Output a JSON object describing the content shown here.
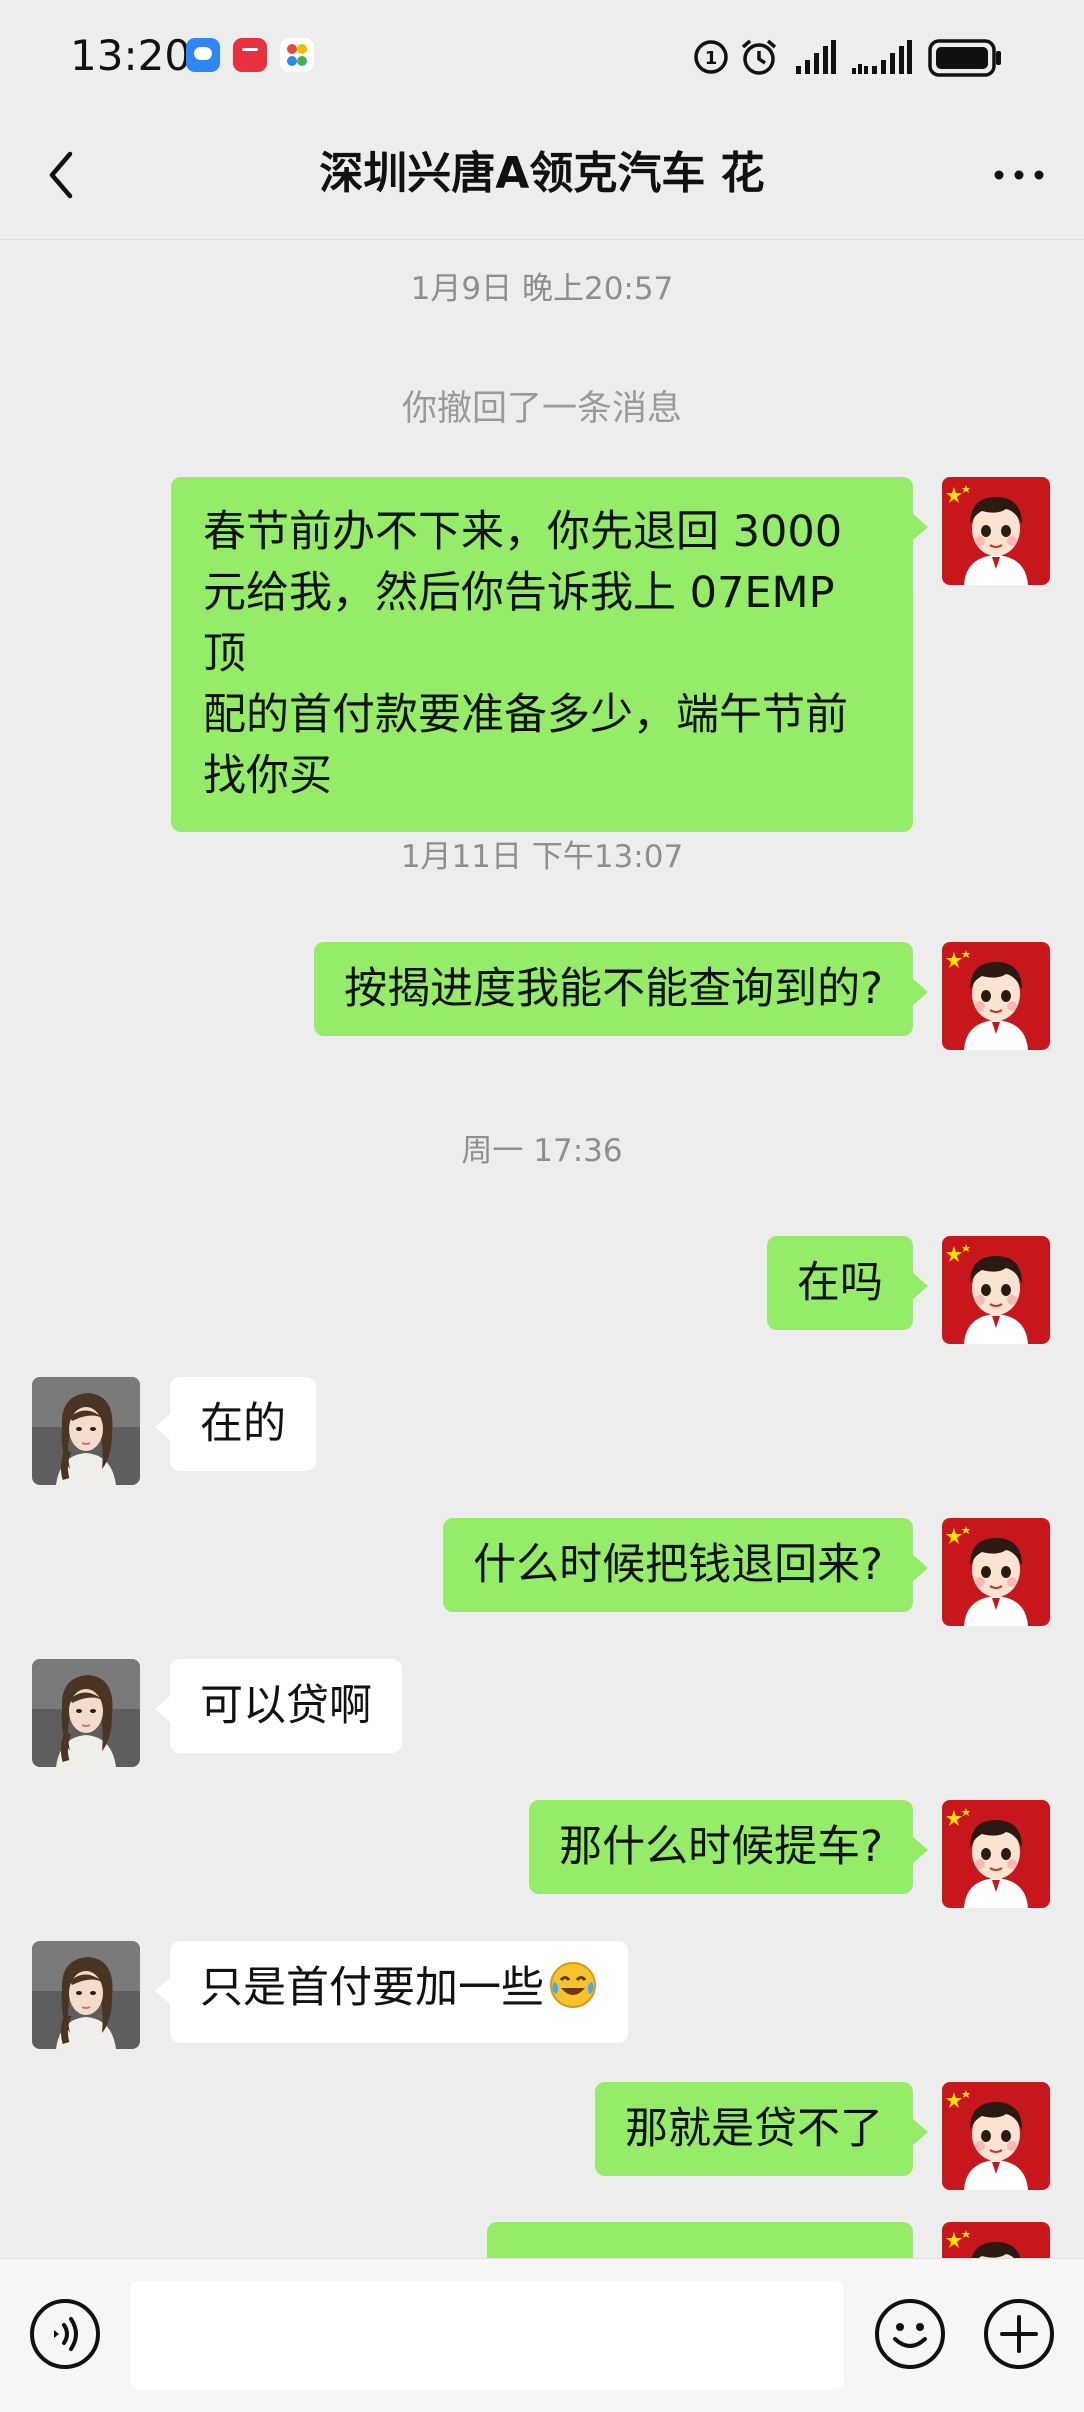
{
  "status_bar": {
    "time": "13:20",
    "network_badge": "1"
  },
  "header": {
    "title": "深圳兴唐A领克汽车 花"
  },
  "messages": [
    {
      "kind": "time",
      "text": "1月9日 晚上20:57"
    },
    {
      "kind": "system",
      "text": "你撤回了一条消息"
    },
    {
      "kind": "sent",
      "lines": [
        "春节前办不下来，你先退回 3000",
        "元给我，然后你告诉我上 07EMP 顶",
        "配的首付款要准备多少，端午节前",
        "找你买"
      ]
    },
    {
      "kind": "time",
      "text": "1月11日 下午13:07"
    },
    {
      "kind": "sent",
      "text": "按揭进度我能不能查询到的?"
    },
    {
      "kind": "time",
      "text": "周一 17:36"
    },
    {
      "kind": "sent",
      "text": "在吗"
    },
    {
      "kind": "received",
      "text": "在的"
    },
    {
      "kind": "sent",
      "text": "什么时候把钱退回来?"
    },
    {
      "kind": "received",
      "text": "可以贷啊"
    },
    {
      "kind": "sent",
      "text": "那什么时候提车?"
    },
    {
      "kind": "received",
      "text": "只是首付要加一些",
      "emoji": "face-with-tears-of-joy"
    },
    {
      "kind": "sent",
      "text": "那就是贷不了"
    }
  ],
  "input_bar": {
    "placeholder": ""
  },
  "colors": {
    "background": "#ededed",
    "sent_bubble": "#95ec69",
    "received_bubble": "#ffffff",
    "self_avatar_bg": "#c8161d",
    "timestamp_text": "#8f8f8f"
  },
  "icons": {
    "back": "chevron-left-icon",
    "more": "more-dots-icon",
    "voice": "voice-icon",
    "emoji": "emoji-icon",
    "plus": "plus-icon"
  }
}
